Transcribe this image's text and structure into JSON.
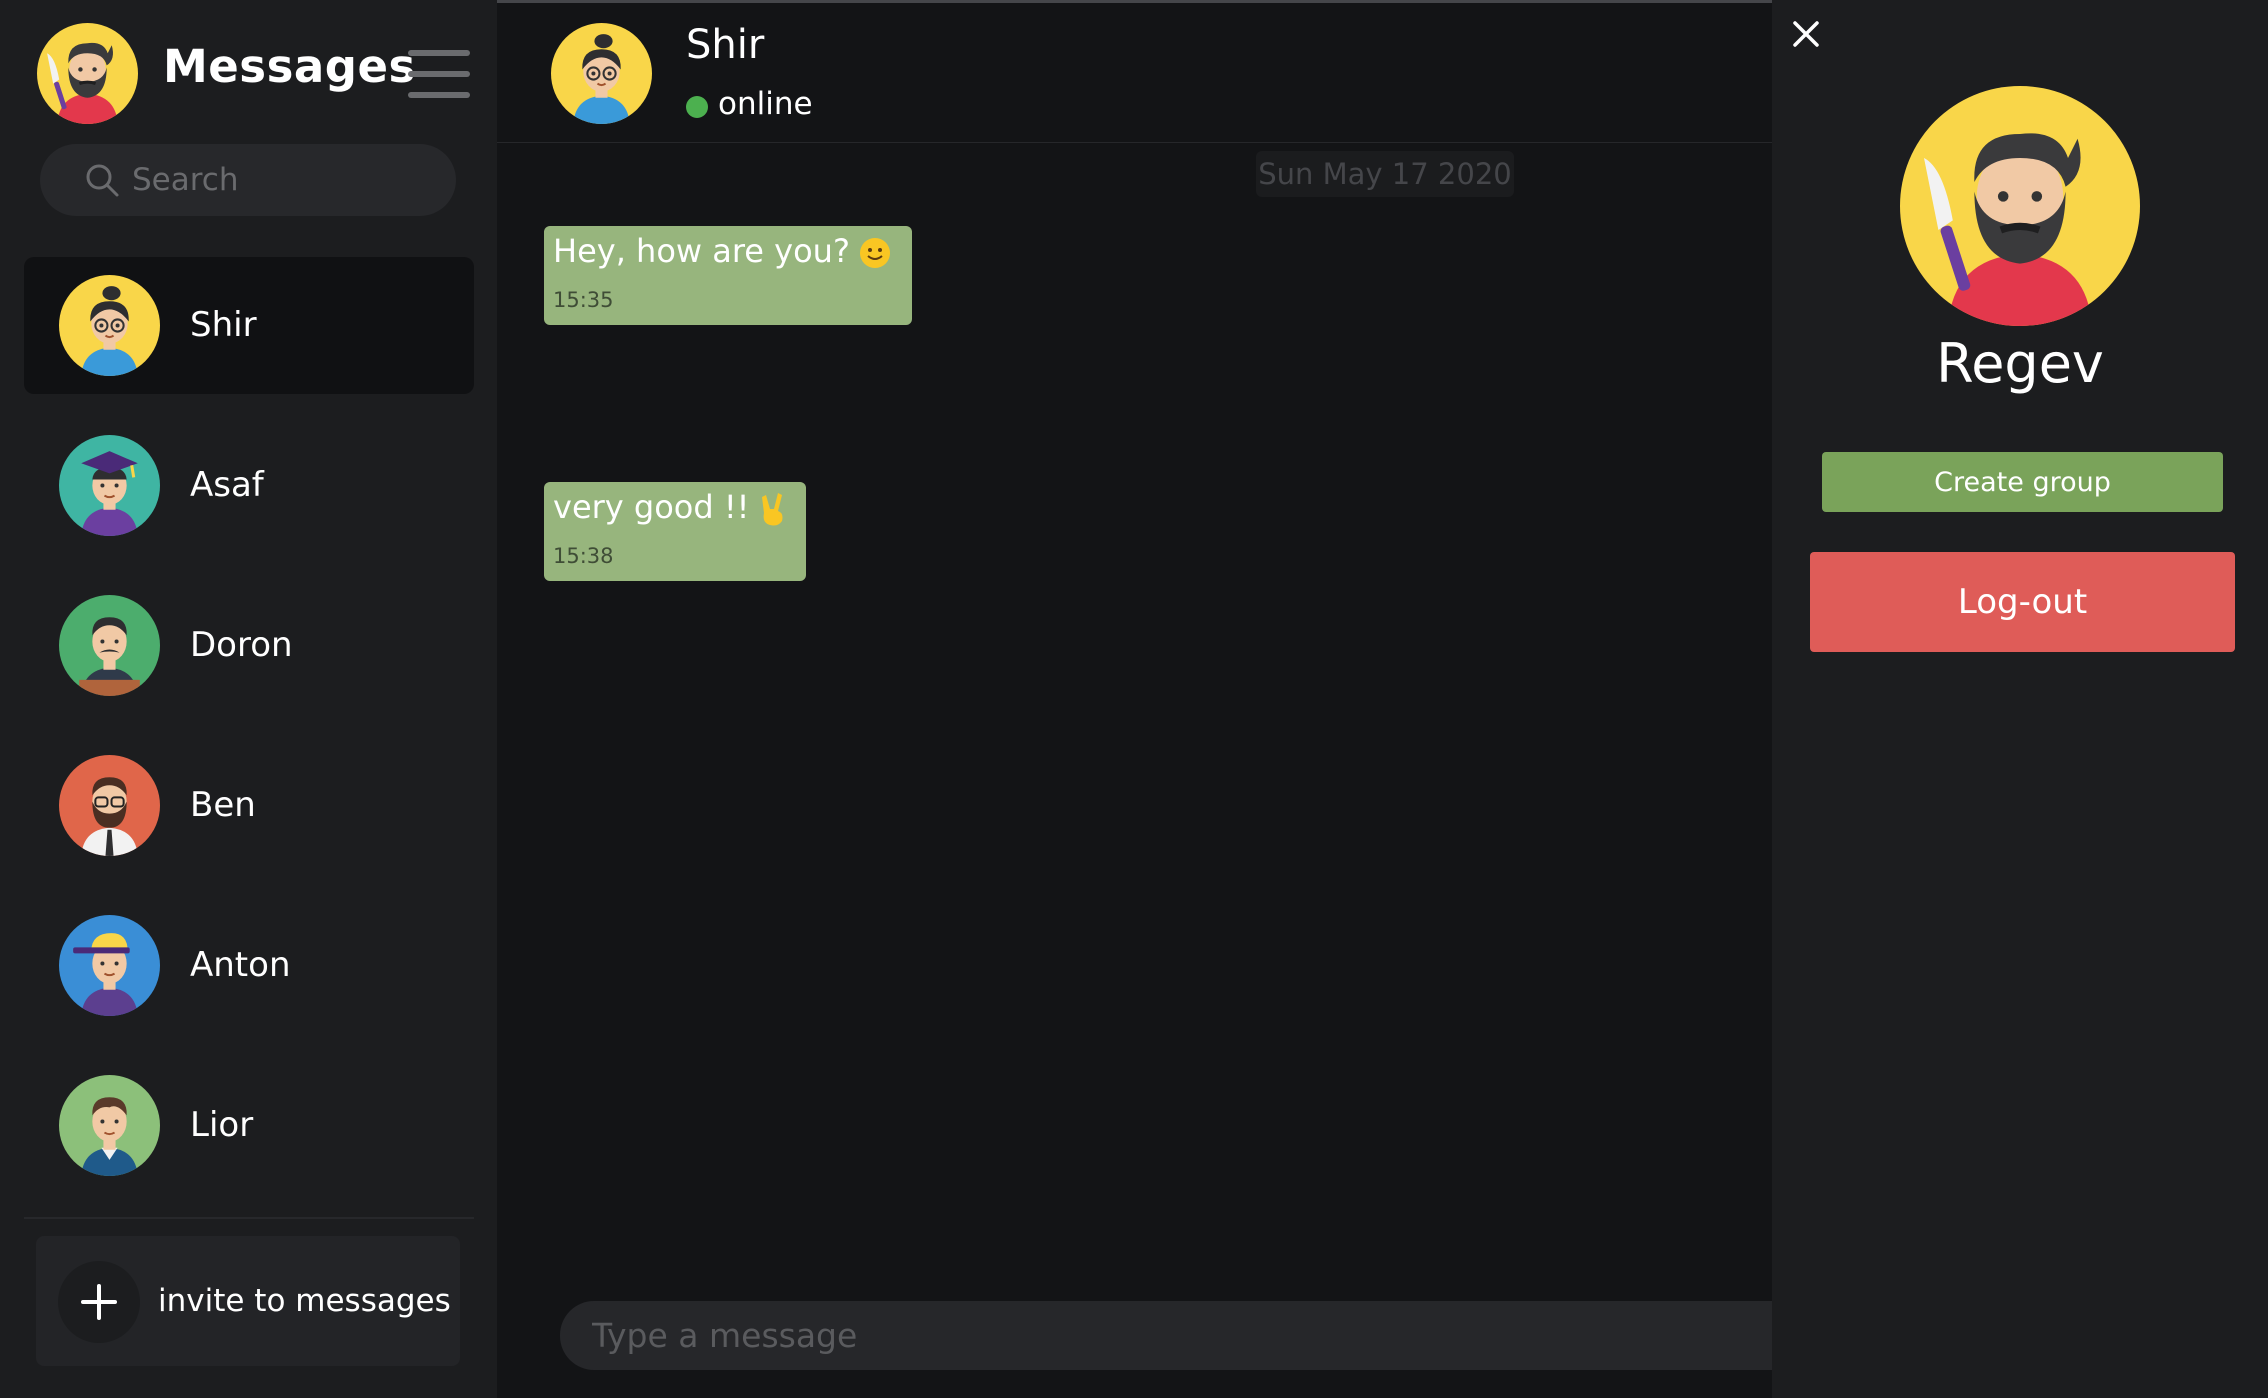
{
  "sidebar": {
    "title": "Messages",
    "current_user_avatar": "regev-avatar",
    "search": {
      "placeholder": "Search",
      "icon": "search-icon"
    },
    "contacts": [
      {
        "name": "Shir",
        "avatar": "shir-avatar",
        "active": true
      },
      {
        "name": "Asaf",
        "avatar": "asaf-avatar"
      },
      {
        "name": "Doron",
        "avatar": "doron-avatar"
      },
      {
        "name": "Ben",
        "avatar": "ben-avatar"
      },
      {
        "name": "Anton",
        "avatar": "anton-avatar"
      },
      {
        "name": "Lior",
        "avatar": "lior-avatar"
      }
    ],
    "invite_label": "invite to messages"
  },
  "chat": {
    "contact_name": "Shir",
    "status": "online",
    "date_divider": "Sun May 17 2020",
    "messages": [
      {
        "text": "Hey, how are you?",
        "emoji": "slightly-smiling-face",
        "time": "15:35"
      },
      {
        "text": "very good !!",
        "emoji": "victory-hand",
        "time": "15:38"
      }
    ],
    "composer_placeholder": "Type a message"
  },
  "profile_panel": {
    "name": "Regev",
    "create_group_label": "Create group",
    "logout_label": "Log-out"
  },
  "colors": {
    "background": "#131416",
    "sidebar": "#1c1d1f",
    "bubble": "#97b57d",
    "online": "#4cb04f",
    "create_group": "#7aa35a",
    "logout": "#df5c58"
  }
}
